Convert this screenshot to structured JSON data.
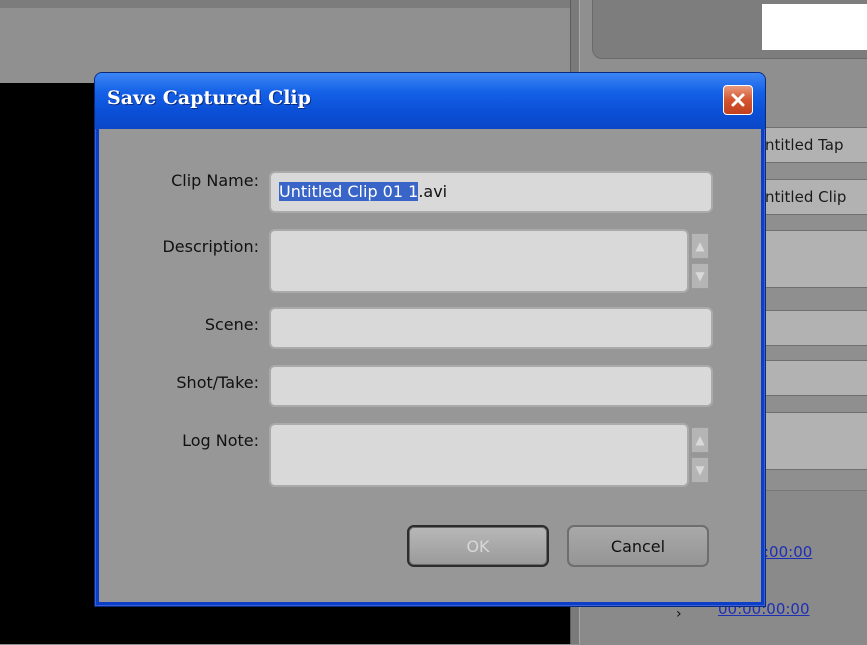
{
  "dialog": {
    "title": "Save Captured Clip",
    "fields": {
      "clip_name": {
        "label": "Clip Name:",
        "value_selected": "Untitled Clip 01 1",
        "value_rest": ".avi"
      },
      "description": {
        "label": "Description:",
        "value": ""
      },
      "scene": {
        "label": "Scene:",
        "value": ""
      },
      "shot_take": {
        "label": "Shot/Take:",
        "value": ""
      },
      "log_note": {
        "label": "Log Note:",
        "value": ""
      }
    },
    "buttons": {
      "ok": "OK",
      "cancel": "Cancel"
    }
  },
  "background_panel": {
    "tape_name_partial": "ntitled Tap",
    "clip_name_partial": "ntitled Clip",
    "timecode_in_partial": ":00:00",
    "timecode_out": "00:00:00:00",
    "colors": {
      "timecode": "#1d2fb5"
    }
  },
  "colors": {
    "titlebar": "#0b48c8",
    "selection": "#3965c9",
    "close_button": "#d4552f"
  }
}
